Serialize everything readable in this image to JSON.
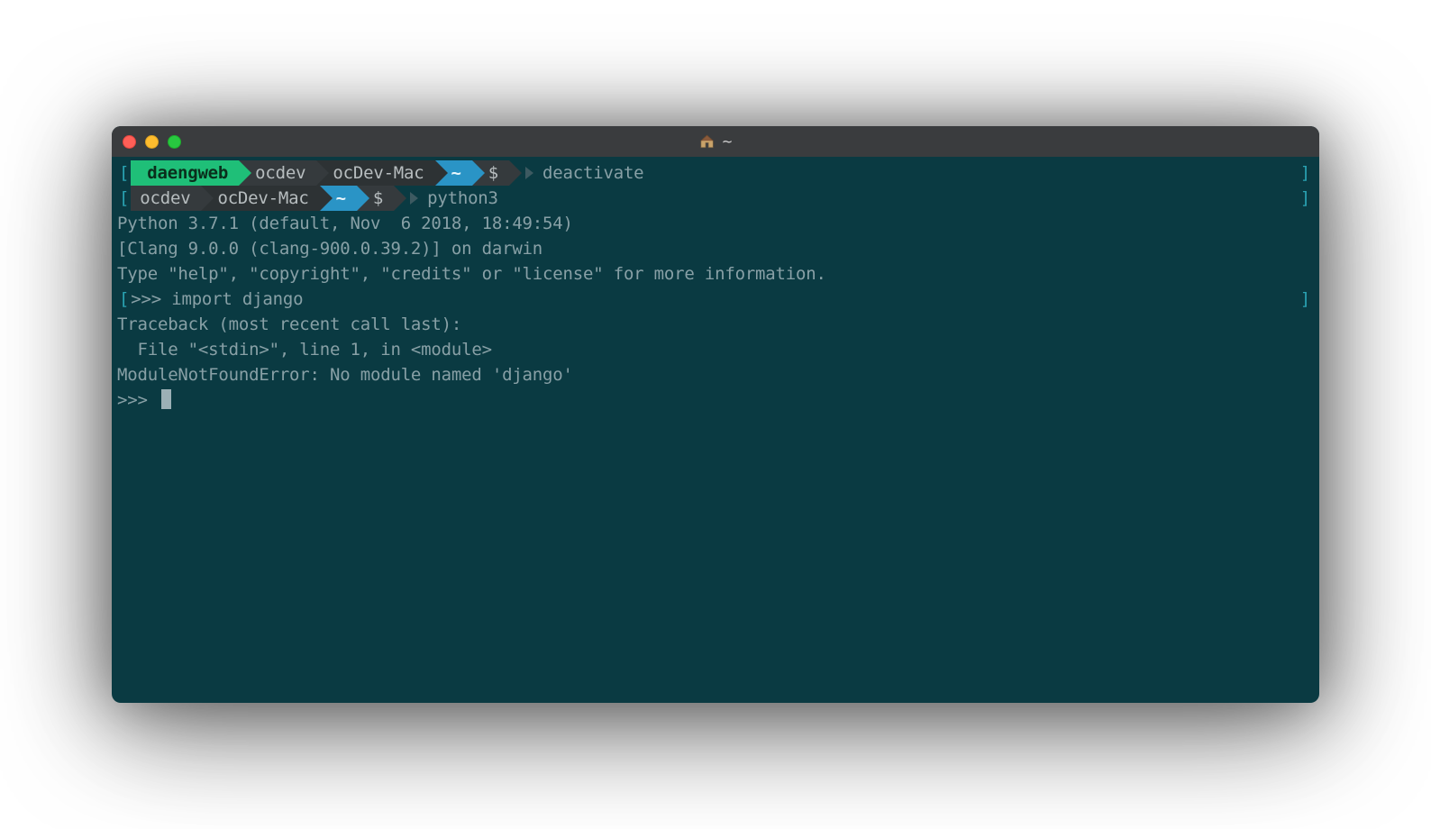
{
  "titlebar": {
    "title": "~"
  },
  "prompt1": {
    "open_bracket": "[",
    "close_bracket": "]",
    "segs": {
      "venv": "daengweb",
      "user": "ocdev",
      "host": "ocDev-Mac",
      "path": "~",
      "symbol": "$"
    },
    "command": "deactivate"
  },
  "prompt2": {
    "open_bracket": "[",
    "close_bracket": "]",
    "segs": {
      "user": "ocdev",
      "host": "ocDev-Mac",
      "path": "~",
      "symbol": "$"
    },
    "command": "python3"
  },
  "output": {
    "line1": "Python 3.7.1 (default, Nov  6 2018, 18:49:54) ",
    "line2": "[Clang 9.0.0 (clang-900.0.39.2)] on darwin",
    "line3": "Type \"help\", \"copyright\", \"credits\" or \"license\" for more information."
  },
  "repl1": {
    "open_bracket": "[",
    "close_bracket": "]",
    "prompt": ">>> ",
    "input": "import django"
  },
  "traceback": {
    "line1": "Traceback (most recent call last):",
    "line2": "  File \"<stdin>\", line 1, in <module>",
    "line3": "ModuleNotFoundError: No module named 'django'"
  },
  "repl2": {
    "prompt": ">>> "
  }
}
